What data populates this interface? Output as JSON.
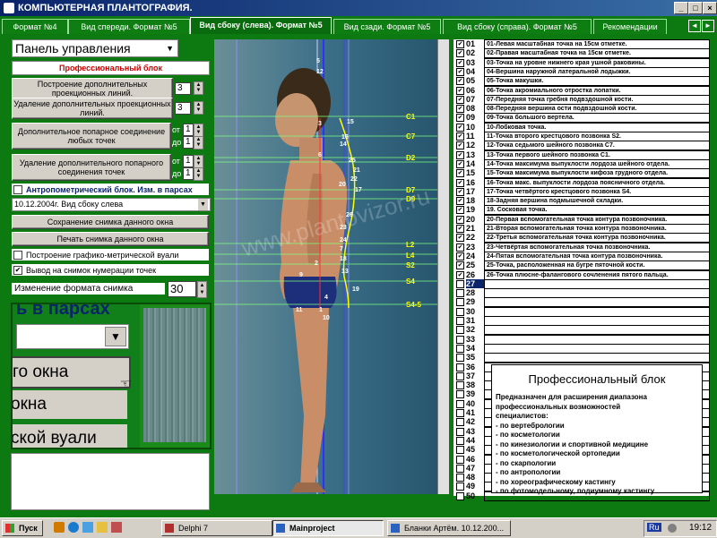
{
  "window": {
    "title": "КОМПЬЮТЕРНАЯ ПЛАНТОГРАФИЯ.",
    "controls": [
      "_",
      "□",
      "×"
    ]
  },
  "tabs": [
    {
      "label": "Формат №4",
      "active": false
    },
    {
      "label": "Вид спереди. Формат №5",
      "active": false
    },
    {
      "label": "Вид сбоку (слева). Формат №5",
      "active": true
    },
    {
      "label": "Вид сзади. Формат №5",
      "active": false
    },
    {
      "label": "Вид сбоку (справа). Формат №5",
      "active": false
    },
    {
      "label": "Рекомендации",
      "active": false
    }
  ],
  "left": {
    "panel_select": "Панель управления",
    "pro_block_title": "Профессиональный блок",
    "build_lines": {
      "label": "Построение дополнительных проекционных линий.",
      "value": "3"
    },
    "remove_lines": {
      "label": "Удаление дополнительных проекционных линий.",
      "value": "3"
    },
    "add_polar": {
      "label": "Дополнительное попарное соединение любых точек",
      "from_label": "от",
      "from": "1",
      "to_label": "до",
      "to": "1"
    },
    "remove_polar": {
      "label": "Удаление дополнительного попарного соединения точек",
      "from_label": "от",
      "from": "1",
      "to_label": "до",
      "to": "1"
    },
    "anthropometric": "Антропометрический блок. Изм. в парсах",
    "date_select": "10.12.2004г. Вид сбоку слева",
    "save_snapshot": "Сохранение снимка данного окна",
    "print_snapshot": "Печать снимка данного окна",
    "build_graph": "Построение графико-метрической вуали",
    "show_numbering": "Вывод на снимок нумерации точек",
    "change_format": "Изменение формата снимка",
    "format_value": "30",
    "zoom_texts": [
      "ь в парсах",
      "го окна",
      "окна",
      "ской вуали"
    ]
  },
  "photo": {
    "watermark": "www.plantovizor.ru",
    "spine_labels": [
      "C1",
      "C7",
      "D2",
      "D7",
      "D9",
      "L2",
      "L4",
      "S2",
      "S4",
      "S4-5"
    ],
    "point_numbers": [
      "1",
      "3",
      "4",
      "6",
      "8",
      "9",
      "10",
      "11",
      "12",
      "13",
      "14",
      "15",
      "16",
      "17",
      "18",
      "19",
      "20",
      "21",
      "22",
      "23",
      "24",
      "25",
      "26",
      "7",
      "5",
      "2"
    ]
  },
  "points": {
    "rows": [
      {
        "n": "01",
        "checked": true,
        "desc": "01-Левая масштабная точка на 15см отметке."
      },
      {
        "n": "02",
        "checked": true,
        "desc": "02-Правая масштабная точка на 15см отметке."
      },
      {
        "n": "03",
        "checked": true,
        "desc": "03-Точка на уровне нижнего края ушной раковины."
      },
      {
        "n": "04",
        "checked": true,
        "desc": "04-Вершина наружной латеральной лодыжки."
      },
      {
        "n": "05",
        "checked": true,
        "desc": "05-Точка макушки."
      },
      {
        "n": "06",
        "checked": true,
        "desc": "06-Точка акромиального отростка лопатки."
      },
      {
        "n": "07",
        "checked": true,
        "desc": "07-Передняя точка гребня подвздошной кости."
      },
      {
        "n": "08",
        "checked": true,
        "desc": "08-Передняя вершина ости подвздошной кости."
      },
      {
        "n": "09",
        "checked": true,
        "desc": "09-Точка большого вертела."
      },
      {
        "n": "10",
        "checked": true,
        "desc": "10-Лобковая точка."
      },
      {
        "n": "11",
        "checked": true,
        "desc": "11-Точка второго крестцового позвонка S2."
      },
      {
        "n": "12",
        "checked": true,
        "desc": "12-Точка седьмого шейного позвонка C7."
      },
      {
        "n": "13",
        "checked": true,
        "desc": "13-Точка первого шейного позвонка C1."
      },
      {
        "n": "14",
        "checked": true,
        "desc": "14-Точка максимума выпуклости лордоза шейного отдела."
      },
      {
        "n": "15",
        "checked": true,
        "desc": "15-Точка максимума выпуклости кифоза грудного отдела."
      },
      {
        "n": "16",
        "checked": true,
        "desc": "16-Точка макс. выпуклости лордоза поясничного отдела."
      },
      {
        "n": "17",
        "checked": true,
        "desc": "17-Точка четвёртого крестцового позвонка S4."
      },
      {
        "n": "18",
        "checked": true,
        "desc": "18-Задняя вершина подмышечной складки."
      },
      {
        "n": "19",
        "checked": true,
        "desc": "19. Сосковая точка."
      },
      {
        "n": "20",
        "checked": true,
        "desc": "20-Первая вспомогательная точка контура позвоночника."
      },
      {
        "n": "21",
        "checked": true,
        "desc": "21-Вторая вспомогательная точка контура позвоночника."
      },
      {
        "n": "22",
        "checked": true,
        "desc": "22-Третья вспомогательная точка контура позвоночника."
      },
      {
        "n": "23",
        "checked": true,
        "desc": "23-Четвёртая вспомогательная точка позвоночника."
      },
      {
        "n": "24",
        "checked": true,
        "desc": "24-Пятая вспомогательная точка контура позвоночника."
      },
      {
        "n": "25",
        "checked": true,
        "desc": "25-Точка, расположенная на бугре пяточной кости."
      },
      {
        "n": "26",
        "checked": true,
        "desc": "26-Точка плюсне-фалангового сочленения пятого пальца."
      },
      {
        "n": "27",
        "checked": false,
        "desc": "",
        "selected": true
      },
      {
        "n": "28",
        "checked": false,
        "desc": ""
      },
      {
        "n": "29",
        "checked": false,
        "desc": ""
      },
      {
        "n": "30",
        "checked": false,
        "desc": ""
      },
      {
        "n": "31",
        "checked": false,
        "desc": ""
      },
      {
        "n": "32",
        "checked": false,
        "desc": ""
      },
      {
        "n": "33",
        "checked": false,
        "desc": ""
      },
      {
        "n": "34",
        "checked": false,
        "desc": ""
      },
      {
        "n": "35",
        "checked": false,
        "desc": ""
      },
      {
        "n": "36",
        "checked": false,
        "desc": ""
      },
      {
        "n": "37",
        "checked": false,
        "desc": ""
      },
      {
        "n": "38",
        "checked": false,
        "desc": ""
      },
      {
        "n": "39",
        "checked": false,
        "desc": ""
      },
      {
        "n": "40",
        "checked": false,
        "desc": ""
      },
      {
        "n": "41",
        "checked": false,
        "desc": ""
      },
      {
        "n": "42",
        "checked": false,
        "desc": ""
      },
      {
        "n": "43",
        "checked": false,
        "desc": ""
      },
      {
        "n": "44",
        "checked": false,
        "desc": ""
      },
      {
        "n": "45",
        "checked": false,
        "desc": ""
      },
      {
        "n": "46",
        "checked": false,
        "desc": ""
      },
      {
        "n": "47",
        "checked": false,
        "desc": ""
      },
      {
        "n": "48",
        "checked": false,
        "desc": ""
      },
      {
        "n": "49",
        "checked": false,
        "desc": ""
      },
      {
        "n": "50",
        "checked": false,
        "desc": ""
      }
    ]
  },
  "pro_box": {
    "title": "Профессиональный блок",
    "lines": [
      "Предназначен для расширения диапазона",
      "профессиональных возможностей",
      "специалистов:",
      "- по вертебрологии",
      "- по косметологии",
      "- по кинезиологии и спортивной медицине",
      "- по косметологической ортопедии",
      "- по скарпологии",
      "- по антропологии",
      "- по хореографическому кастингу",
      "- по фотомодельному, подиумному кастингу"
    ]
  },
  "taskbar": {
    "start": "Пуск",
    "items": [
      {
        "label": "Delphi 7",
        "active": false
      },
      {
        "label": "Mainproject",
        "active": true
      },
      {
        "label": "Бланки Артём. 10.12.200...",
        "active": false
      }
    ],
    "lang": "Ru",
    "clock": "19:12"
  },
  "colors": {
    "app_bg": "#0c7a10",
    "title_bg": "#0a246a",
    "accent_red": "#cc0000",
    "label_yellow": "#ffff00"
  }
}
